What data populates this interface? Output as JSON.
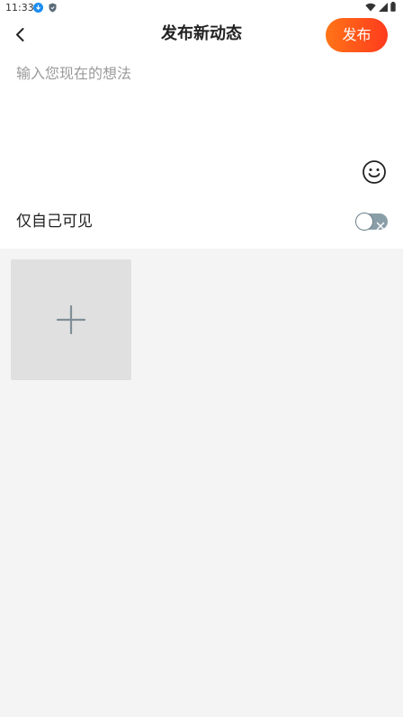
{
  "status_bar": {
    "time": "11:33"
  },
  "header": {
    "title": "发布新动态",
    "publish_label": "发布"
  },
  "composer": {
    "placeholder": "输入您现在的想法",
    "value": ""
  },
  "privacy": {
    "label": "仅自己可见",
    "enabled": false
  },
  "colors": {
    "publish_gradient_start": "#ff7417",
    "publish_gradient_end": "#ff3b1d",
    "page_background": "#f4f4f4",
    "toggle_off": "#8a9ea8"
  },
  "icons": {
    "back": "chevron-left-icon",
    "emoji": "smiley-face-icon",
    "add": "plus-icon"
  }
}
